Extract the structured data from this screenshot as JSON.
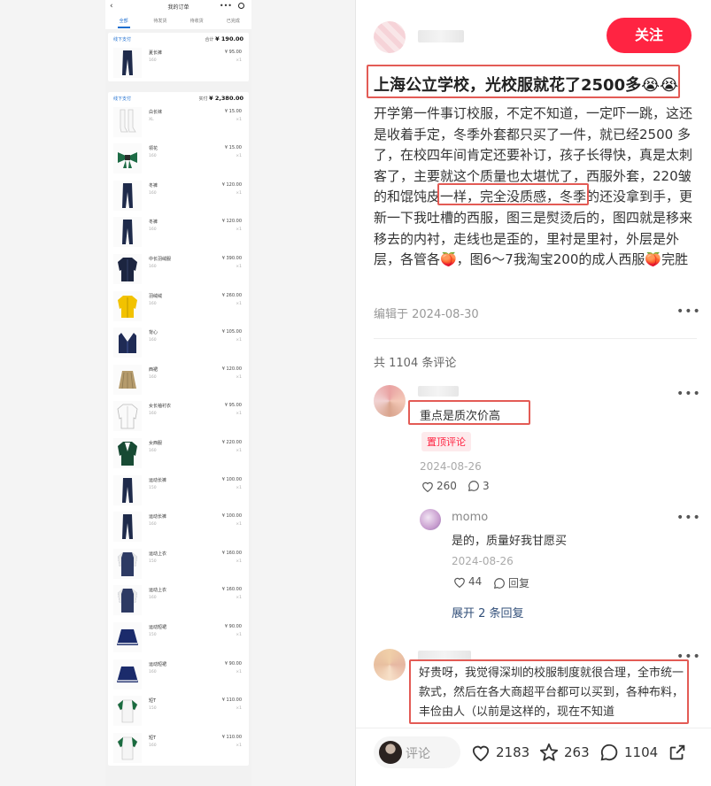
{
  "phone": {
    "title": "我的订单",
    "tabs": [
      "全部",
      "待发货",
      "待收货",
      "已完成"
    ],
    "orders": [
      {
        "status": "线下支付",
        "total_label": "合计",
        "total": "¥ 190.00",
        "items": [
          {
            "name": "夏长裤",
            "size": "160",
            "price": "¥ 95.00",
            "qty": "×1",
            "icon": "navy-pants"
          }
        ]
      },
      {
        "status": "线下支付",
        "total_label": "实付",
        "total": "¥ 2,380.00",
        "items": [
          {
            "name": "白长袜",
            "size": "XL",
            "price": "¥ 15.00",
            "qty": "×1",
            "icon": "white-socks"
          },
          {
            "name": "领花",
            "size": "160",
            "price": "¥ 15.00",
            "qty": "×1",
            "icon": "green-bow-tie"
          },
          {
            "name": "冬裤",
            "size": "160",
            "price": "¥ 120.00",
            "qty": "×1",
            "icon": "navy-pants"
          },
          {
            "name": "冬裤",
            "size": "160",
            "price": "¥ 120.00",
            "qty": "×1",
            "icon": "navy-pants"
          },
          {
            "name": "中长羽绒服",
            "size": "160",
            "price": "¥ 390.00",
            "qty": "×1",
            "icon": "navy-coat"
          },
          {
            "name": "羽绒绒",
            "size": "160",
            "price": "¥ 260.00",
            "qty": "×1",
            "icon": "yellow-jacket"
          },
          {
            "name": "背心",
            "size": "160",
            "price": "¥ 105.00",
            "qty": "×1",
            "icon": "navy-vest"
          },
          {
            "name": "西裙",
            "size": "160",
            "price": "¥ 120.00",
            "qty": "×1",
            "icon": "khaki-skirt"
          },
          {
            "name": "女长袖衬衣",
            "size": "160",
            "price": "¥ 95.00",
            "qty": "×1",
            "icon": "white-shirt"
          },
          {
            "name": "女西服",
            "size": "160",
            "price": "¥ 220.00",
            "qty": "×1",
            "icon": "green-blazer"
          },
          {
            "name": "运动长裤",
            "size": "150",
            "price": "¥ 100.00",
            "qty": "×1",
            "icon": "navy-pants"
          },
          {
            "name": "运动长裤",
            "size": "160",
            "price": "¥ 100.00",
            "qty": "×1",
            "icon": "navy-pants"
          },
          {
            "name": "运动上衣",
            "size": "150",
            "price": "¥ 160.00",
            "qty": "×1",
            "icon": "track-jacket"
          },
          {
            "name": "运动上衣",
            "size": "160",
            "price": "¥ 160.00",
            "qty": "×1",
            "icon": "track-jacket"
          },
          {
            "name": "运动短裙",
            "size": "150",
            "price": "¥ 90.00",
            "qty": "×1",
            "icon": "navy-skirt"
          },
          {
            "name": "运动短裙",
            "size": "160",
            "price": "¥ 90.00",
            "qty": "×1",
            "icon": "navy-skirt"
          },
          {
            "name": "短T",
            "size": "150",
            "price": "¥ 110.00",
            "qty": "×1",
            "icon": "polo-shirt"
          },
          {
            "name": "短T",
            "size": "160",
            "price": "¥ 110.00",
            "qty": "×1",
            "icon": "polo-shirt"
          }
        ]
      }
    ]
  },
  "post": {
    "follow_label": "关注",
    "title": "上海公立学校，光校服就花了2500多😭😭",
    "body": "开学第一件事订校服，不定不知道，一定吓一跳，这还是收着手定，冬季外套都只买了一件，就已经2500 多了，在校四年间肯定还要补订，孩子长得快，真是太刺客了，主要就这个质量也太堪忧了，西服外套，220皱的和馄饨皮一样，完全没质感，冬季的还没拿到手，更新一下我吐槽的西服，图三是熨烫后的，图四就是移来移去的内衬，走线也是歪的，里衬是里衬，外层是外层，各管各🍑，图6～7我淘宝200的成人西服🍑完胜",
    "edited": "编辑于 2024-08-30",
    "comment_count": "共 1104 条评论"
  },
  "comments": [
    {
      "text": "重点是质次价高",
      "badge": "置顶评论",
      "date": "2024-08-26",
      "likes": "260",
      "replies": "3"
    },
    {
      "user": "momo",
      "text": "是的，质量好我甘愿买",
      "date": "2024-08-26",
      "likes": "44",
      "reply_label": "回复",
      "expand": "展开 2 条回复"
    },
    {
      "text": "好贵呀，我觉得深圳的校服制度就很合理，全市统一款式，然后在各大商超平台都可以买到，各种布料，丰俭由人（以前是这样的，现在不知道"
    }
  ],
  "bottom": {
    "placeholder": "评论",
    "likes": "2183",
    "stars": "263",
    "comments": "1104"
  },
  "colors": {
    "accent": "#ff2442",
    "highlight_box": "#e35b55",
    "link": "#1f6fd0"
  }
}
